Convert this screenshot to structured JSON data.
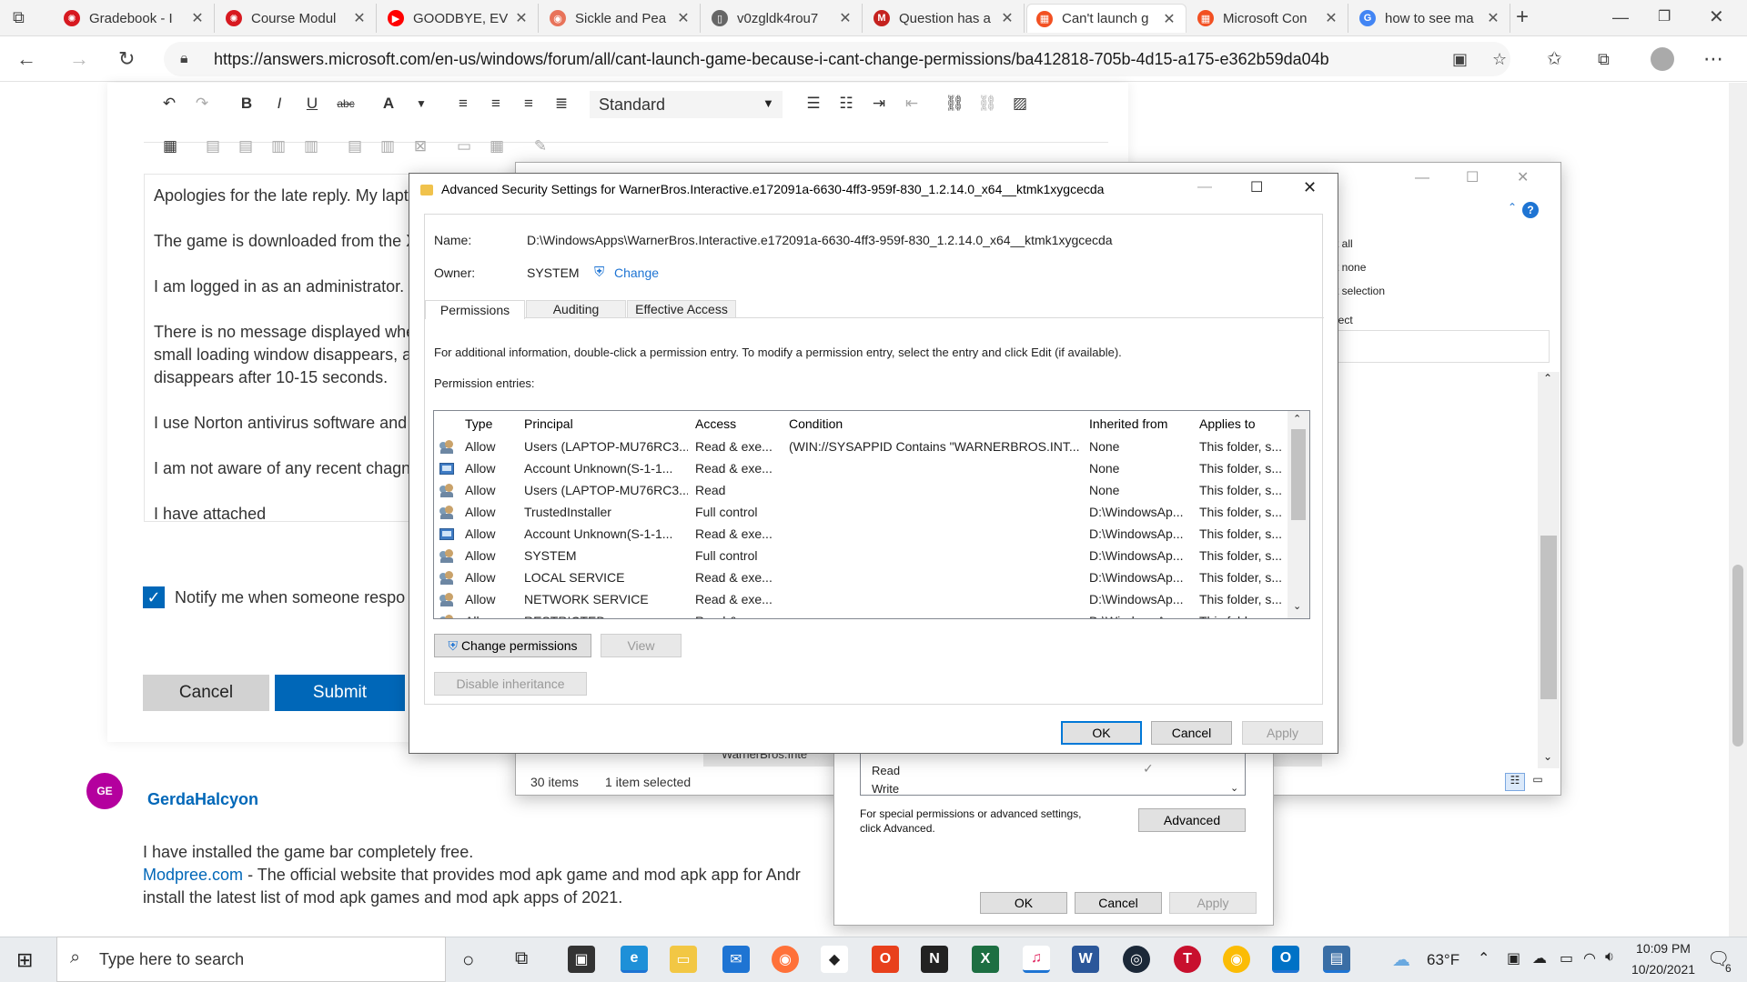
{
  "browser": {
    "tabs": [
      {
        "label": "Gradebook - I",
        "color": "#d71920",
        "glyph": "✺"
      },
      {
        "label": "Course Modul",
        "color": "#d71920",
        "glyph": "✺"
      },
      {
        "label": "GOODBYE, EV",
        "color": "#ff0000",
        "glyph": "▶"
      },
      {
        "label": "Sickle and Pea",
        "color": "#e8735a",
        "glyph": "◉"
      },
      {
        "label": "v0zgldk4rou7",
        "color": "#666666",
        "glyph": "▯"
      },
      {
        "label": "Question has a",
        "color": "#c5221f",
        "glyph": "M"
      },
      {
        "label": "Can't launch g",
        "color": "#f25022",
        "glyph": "▦"
      },
      {
        "label": "Microsoft Con",
        "color": "#f25022",
        "glyph": "▦"
      },
      {
        "label": "how to see ma",
        "color": "#4285f4",
        "glyph": "G"
      }
    ],
    "new_tab": "+",
    "url": "https://answers.microsoft.com/en-us/windows/forum/all/cant-launch-game-because-i-cant-change-permissions/ba412818-705b-4d15-a175-e362b59da04b"
  },
  "editor": {
    "font_select": "Standard",
    "paragraphs": [
      "Apologies for the late reply. My lapto",
      "The game is downloaded from the X",
      "I am logged in as an administrator.",
      "There is no message displayed when",
      "small loading window disappears, as",
      "disappears after 10-15 seconds.",
      "I use Norton antivirus software and t",
      "I am not aware of any recent chagne",
      "I have attached"
    ],
    "notify_label": "Notify me when someone respo",
    "cancel": "Cancel",
    "submit": "Submit"
  },
  "reply": {
    "avatar": "GE",
    "author": "GerdaHalcyon",
    "line1": "I have installed the game bar completely free.",
    "link": "Modpree.com",
    "line2": " - The official website that provides mod apk game and mod apk app for Andr",
    "line3": "install the latest list of mod apk games and mod apk apps of 2021."
  },
  "explorer": {
    "ribbon": [
      "t all",
      "t none",
      "t selection",
      "lect"
    ],
    "status_items": "30 items",
    "status_selected": "1 item selected",
    "folder": "WarnerBros.Inte"
  },
  "props_dialog": {
    "perm_rows": [
      "Read",
      "Write"
    ],
    "special_text": "For special permissions or advanced settings, click Advanced.",
    "advanced": "Advanced",
    "ok": "OK",
    "cancel": "Cancel",
    "apply": "Apply"
  },
  "adv_dialog": {
    "title": "Advanced Security Settings for WarnerBros.Interactive.e172091a-6630-4ff3-959f-830_1.2.14.0_x64__ktmk1xygcecda",
    "name_label": "Name:",
    "name_value": "D:\\WindowsApps\\WarnerBros.Interactive.e172091a-6630-4ff3-959f-830_1.2.14.0_x64__ktmk1xygcecda",
    "owner_label": "Owner:",
    "owner_value": "SYSTEM",
    "change": "Change",
    "tabs": [
      "Permissions",
      "Auditing",
      "Effective Access"
    ],
    "info": "For additional information, double-click a permission entry. To modify a permission entry, select the entry and click Edit (if available).",
    "entries_label": "Permission entries:",
    "columns": [
      "Type",
      "Principal",
      "Access",
      "Condition",
      "Inherited from",
      "Applies to"
    ],
    "rows": [
      {
        "type": "Allow",
        "principal": "Users (LAPTOP-MU76RC3...",
        "access": "Read & exe...",
        "condition": "(WIN://SYSAPPID Contains \"WARNERBROS.INT...",
        "inherited": "None",
        "applies": "This folder, s...",
        "icon": "group"
      },
      {
        "type": "Allow",
        "principal": "Account Unknown(S-1-1...",
        "access": "Read & exe...",
        "condition": "",
        "inherited": "None",
        "applies": "This folder, s...",
        "icon": "unknown"
      },
      {
        "type": "Allow",
        "principal": "Users (LAPTOP-MU76RC3...",
        "access": "Read",
        "condition": "",
        "inherited": "None",
        "applies": "This folder, s...",
        "icon": "group"
      },
      {
        "type": "Allow",
        "principal": "TrustedInstaller",
        "access": "Full control",
        "condition": "",
        "inherited": "D:\\WindowsAp...",
        "applies": "This folder, s...",
        "icon": "group"
      },
      {
        "type": "Allow",
        "principal": "Account Unknown(S-1-1...",
        "access": "Read & exe...",
        "condition": "",
        "inherited": "D:\\WindowsAp...",
        "applies": "This folder, s...",
        "icon": "unknown"
      },
      {
        "type": "Allow",
        "principal": "SYSTEM",
        "access": "Full control",
        "condition": "",
        "inherited": "D:\\WindowsAp...",
        "applies": "This folder, s...",
        "icon": "group"
      },
      {
        "type": "Allow",
        "principal": "LOCAL SERVICE",
        "access": "Read & exe...",
        "condition": "",
        "inherited": "D:\\WindowsAp...",
        "applies": "This folder, s...",
        "icon": "group"
      },
      {
        "type": "Allow",
        "principal": "NETWORK SERVICE",
        "access": "Read & exe...",
        "condition": "",
        "inherited": "D:\\WindowsAp...",
        "applies": "This folder, s...",
        "icon": "group"
      },
      {
        "type": "Allow",
        "principal": "RESTRICTED",
        "access": "Read & exe...",
        "condition": "",
        "inherited": "D:\\WindowsAp...",
        "applies": "This folder, s...",
        "icon": "group"
      }
    ],
    "change_permissions": "Change permissions",
    "view": "View",
    "disable_inheritance": "Disable inheritance",
    "ok": "OK",
    "cancel": "Cancel",
    "apply": "Apply"
  },
  "taskbar": {
    "search_placeholder": "Type here to search",
    "weather": "63°F",
    "time": "10:09 PM",
    "date": "10/20/2021",
    "notifications": "6"
  }
}
